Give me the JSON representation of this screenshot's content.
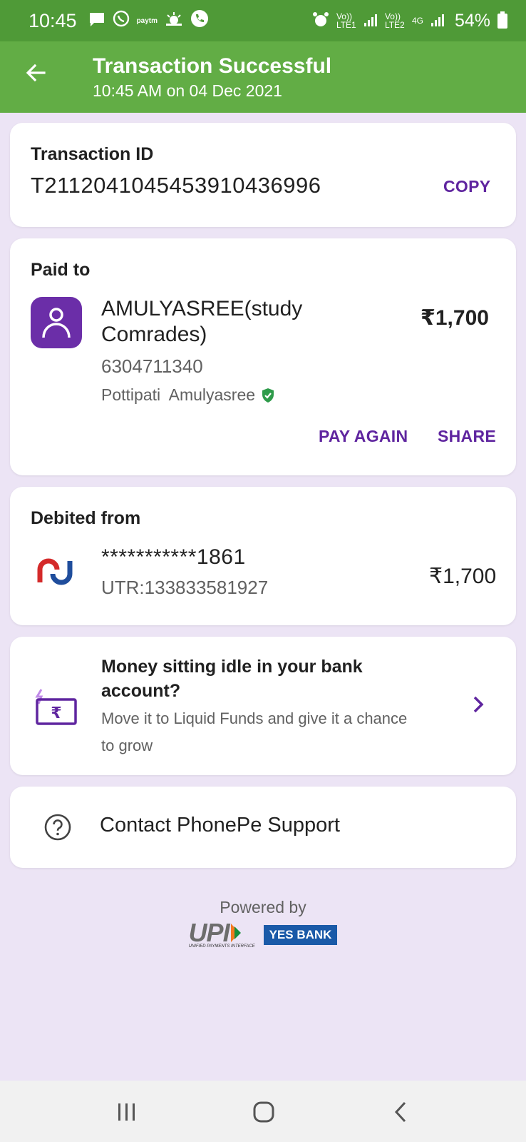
{
  "status_bar": {
    "time": "10:45",
    "paytm_label": "paytm",
    "sim1": "Vo)) LTE1",
    "sim2": "Vo)) LTE2",
    "network": "4G",
    "battery": "54%"
  },
  "app_bar": {
    "title": "Transaction Successful",
    "subtitle": "10:45 AM on 04 Dec 2021"
  },
  "transaction": {
    "label": "Transaction ID",
    "id": "T2112041045453910436996",
    "copy_label": "COPY"
  },
  "paid_to": {
    "label": "Paid to",
    "name_line1": "AMULYASREE(study",
    "name_line2": "Comrades)",
    "phone": "6304711340",
    "verified_name": "Pottipati  Amulyasree",
    "amount": "₹1,700",
    "pay_again_label": "PAY AGAIN",
    "share_label": "SHARE"
  },
  "debited_from": {
    "label": "Debited from",
    "account": "***********1861",
    "utr": "UTR:133833581927",
    "amount": "₹1,700"
  },
  "promo": {
    "title_line1": "Money sitting idle in your bank",
    "title_line2": "account?",
    "desc_line1": "Move it to Liquid Funds and give it a chance",
    "desc_line2": "to grow"
  },
  "support": {
    "label": "Contact PhonePe Support"
  },
  "footer": {
    "powered_by": "Powered by",
    "upi_text": "UPI",
    "upi_sub": "UNIFIED PAYMENTS INTERFACE",
    "bank_text": "YES BANK"
  },
  "colors": {
    "status_bar": "#4f9a37",
    "app_bar": "#62ad45",
    "accent_purple": "#5f259f",
    "background": "#ece4f5"
  }
}
